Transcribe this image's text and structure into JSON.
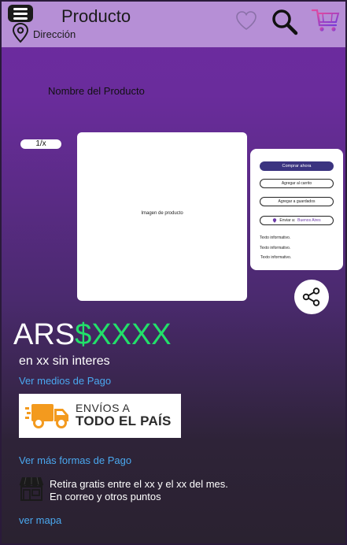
{
  "header": {
    "title": "Producto",
    "address_label": "Dirección",
    "icons": [
      "menu-icon",
      "location-pin-icon",
      "heart-icon",
      "search-icon",
      "cart-icon"
    ]
  },
  "product": {
    "name": "Nombre del Producto",
    "image_counter": "1/x",
    "image_placeholder": "Imagen de producto"
  },
  "actions": {
    "buy_now": "Comprar ahora",
    "add_to_cart": "Agregar al carrito",
    "add_to_saved": "Agregar a guardados",
    "send_to_label": "Enviar a:",
    "send_to_city": "Buenos Aires",
    "info_lines": [
      "Texto informativo.",
      "Texto informativo.",
      "Texto informativo."
    ]
  },
  "price": {
    "currency": "ARS",
    "amount": "$XXXX",
    "installments": "en xx sin interes",
    "payment_methods_link": "Ver medios de Pago",
    "more_payment_link": "Ver más formas de Pago"
  },
  "shipping": {
    "line1": "ENVÍOS A",
    "line2": "TODO EL PAÍS"
  },
  "pickup": {
    "line1": "Retira gratis entre el xx y el xx del mes.",
    "line2": "En correo y otros puntos",
    "map_link": "ver mapa"
  },
  "colors": {
    "header_bg": "#b68fd6",
    "price_accent": "#22e06a",
    "link": "#4aa8ef",
    "primary_button": "#3b3480",
    "shipping_orange": "#f39a1e"
  }
}
